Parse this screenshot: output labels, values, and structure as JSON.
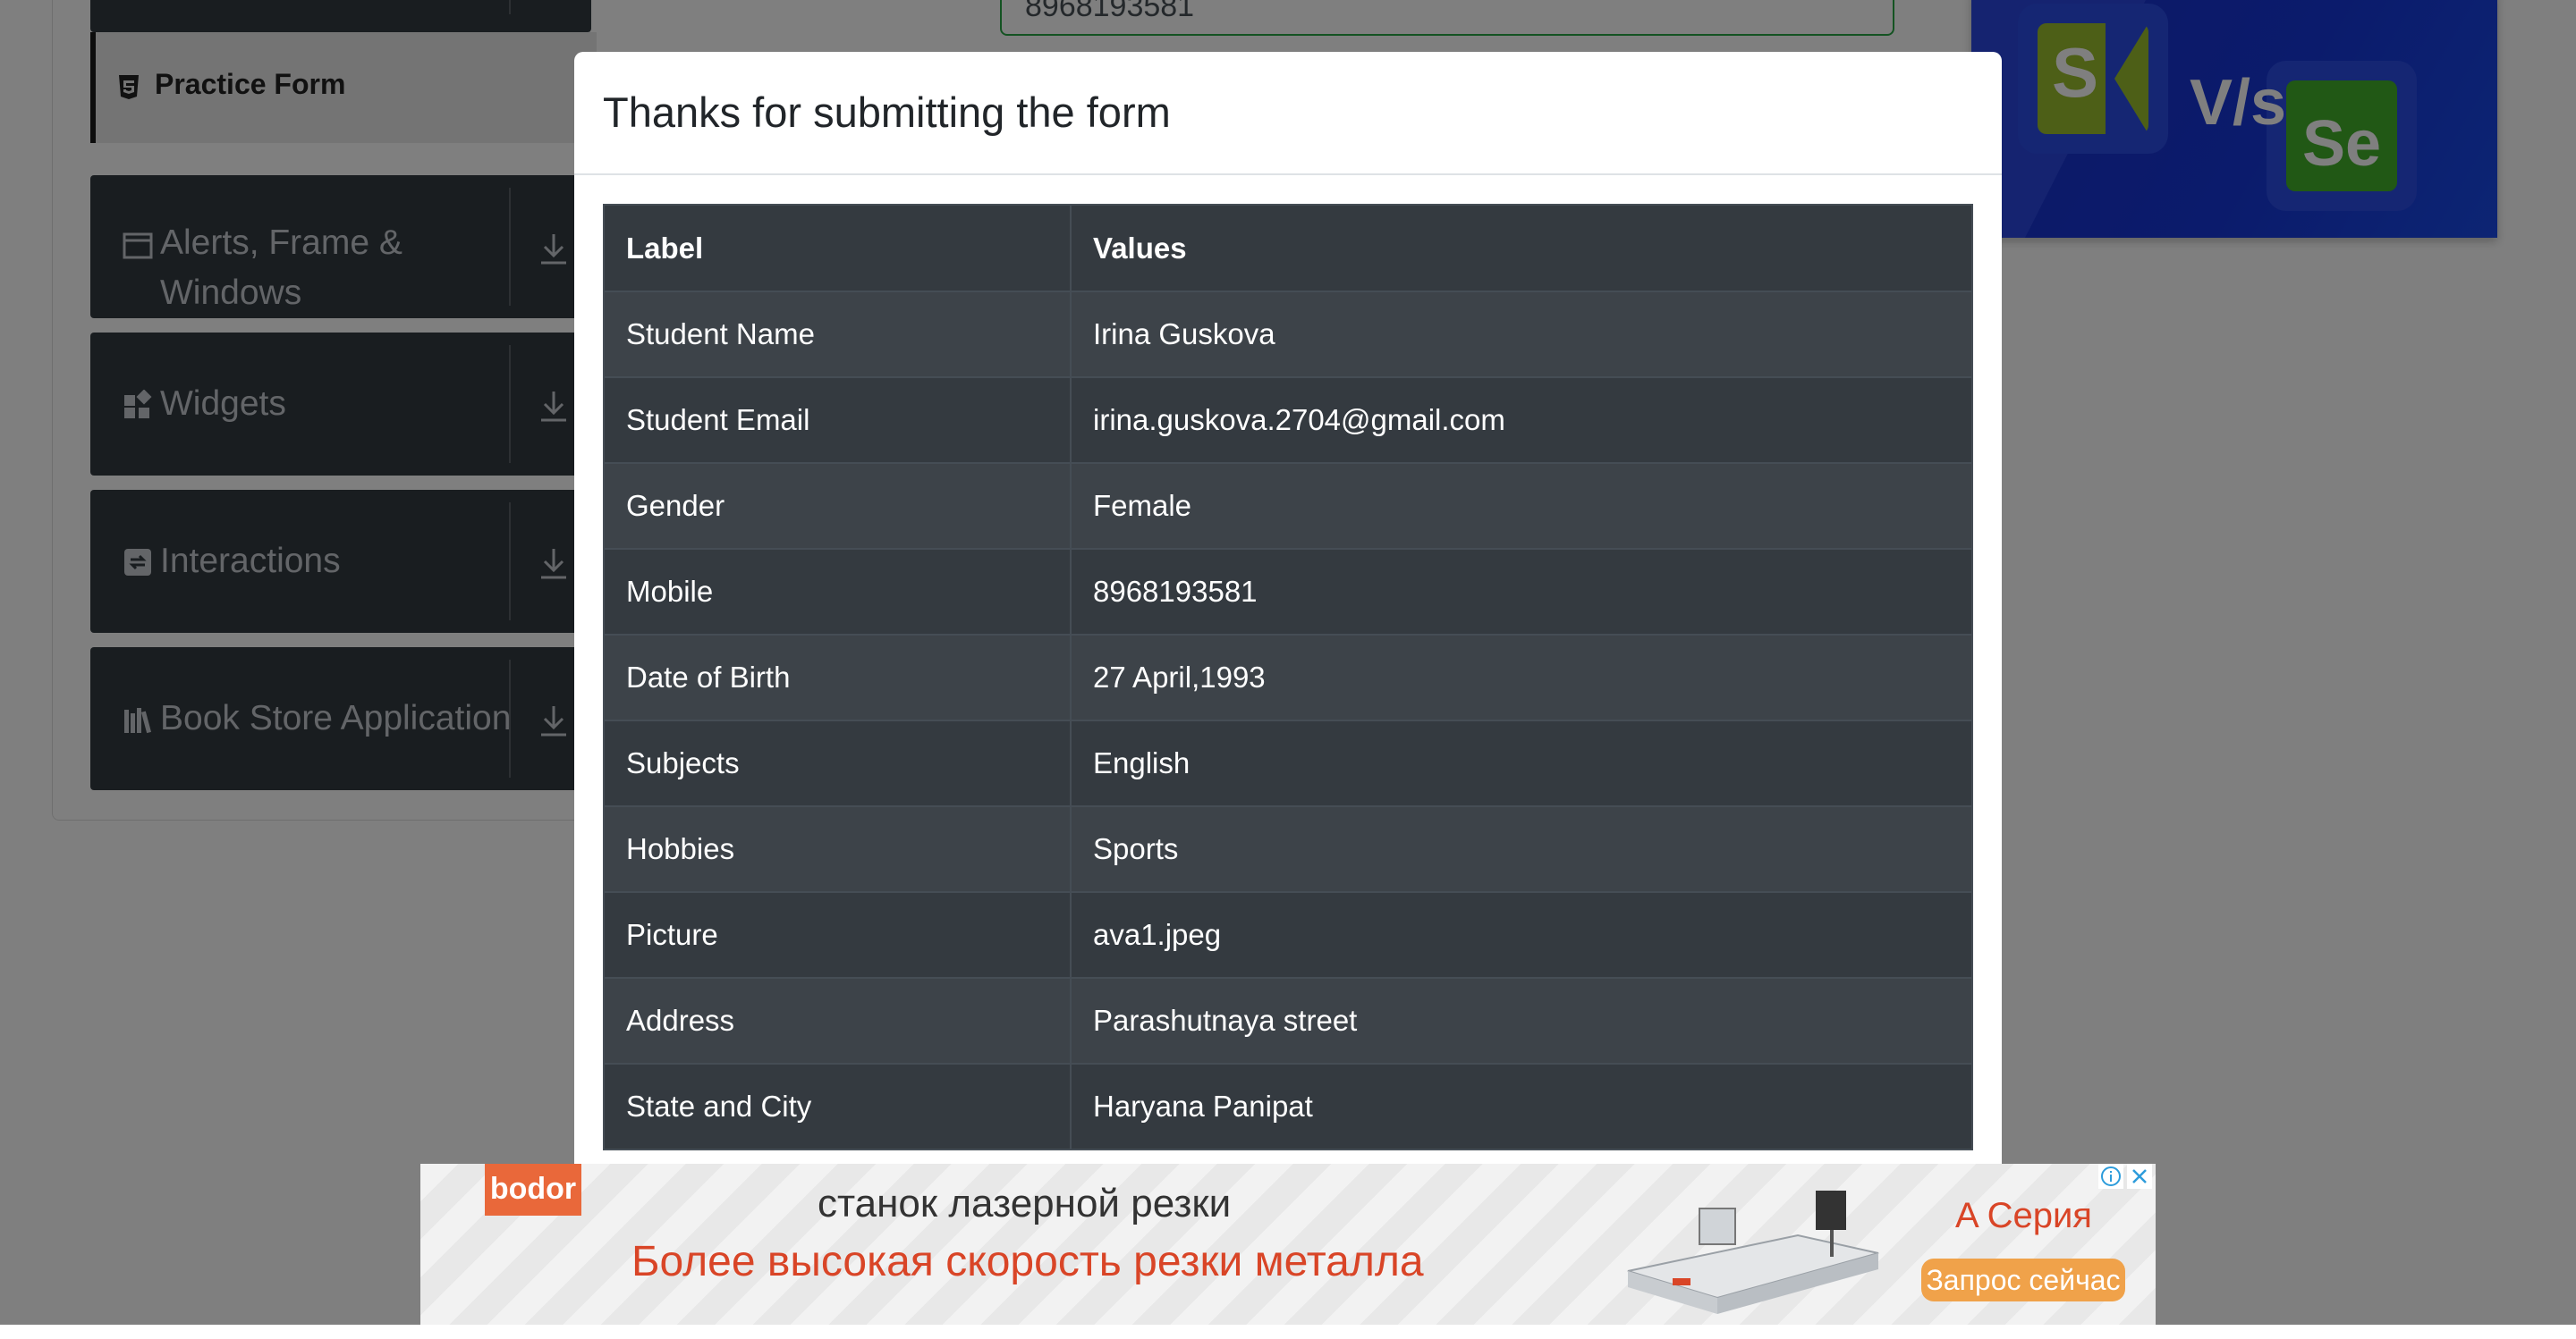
{
  "sidebar": {
    "practice_form": "Practice Form",
    "groups": [
      {
        "label_line1": "Alerts, Frame &",
        "label_line2": "Windows",
        "icon": "window-icon"
      },
      {
        "label": "Widgets",
        "icon": "widgets-icon"
      },
      {
        "label": "Interactions",
        "icon": "interactions-icon"
      },
      {
        "label": "Book Store Application",
        "icon": "books-icon"
      }
    ]
  },
  "form": {
    "mobile_value": "8968193581"
  },
  "modal": {
    "title": "Thanks for submitting the form",
    "headers": [
      "Label",
      "Values"
    ],
    "rows": [
      {
        "label": "Student Name",
        "value": "Irina Guskova"
      },
      {
        "label": "Student Email",
        "value": "irina.guskova.2704@gmail.com"
      },
      {
        "label": "Gender",
        "value": "Female"
      },
      {
        "label": "Mobile",
        "value": "8968193581"
      },
      {
        "label": "Date of Birth",
        "value": "27 April,1993"
      },
      {
        "label": "Subjects",
        "value": "English"
      },
      {
        "label": "Hobbies",
        "value": "Sports"
      },
      {
        "label": "Picture",
        "value": "ava1.jpeg"
      },
      {
        "label": "Address",
        "value": "Parashutnaya street"
      },
      {
        "label": "State and City",
        "value": "Haryana Panipat"
      }
    ]
  },
  "ad_right": {
    "versus": "V/s",
    "left_logo": "S",
    "right_logo": "Se"
  },
  "banner": {
    "logo": "bodor",
    "line1": "станок лазерной резки",
    "line2": "Более высокая скорость резки металла",
    "series": "A Серия",
    "cta": "Запрос сейчас"
  },
  "colors": {
    "table_dark": "#343a40",
    "table_stripe": "#3d4349",
    "overlay": "rgba(0,0,0,0.5)",
    "valid_green": "#28a745"
  }
}
